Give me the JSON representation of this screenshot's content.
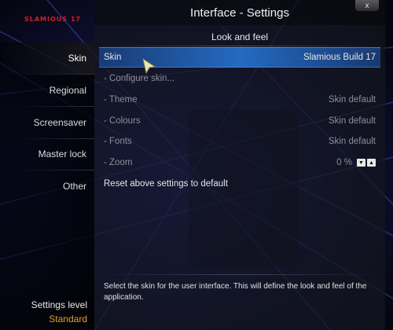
{
  "brand": {
    "logo_text": "SLAMIOUS 17"
  },
  "window": {
    "title": "Interface - Settings",
    "close_label": "x"
  },
  "sidebar": {
    "items": [
      {
        "label": "Skin",
        "active": true
      },
      {
        "label": "Regional",
        "active": false
      },
      {
        "label": "Screensaver",
        "active": false
      },
      {
        "label": "Master lock",
        "active": false
      },
      {
        "label": "Other",
        "active": false
      }
    ],
    "settings_level_label": "Settings level",
    "settings_level_value": "Standard"
  },
  "section": {
    "title": "Look and feel"
  },
  "settings": {
    "skin": {
      "label": "Skin",
      "value": "Slamious Build 17"
    },
    "configure": {
      "label": "- Configure skin..."
    },
    "theme": {
      "label": "- Theme",
      "value": "Skin default"
    },
    "colours": {
      "label": "- Colours",
      "value": "Skin default"
    },
    "fonts": {
      "label": "- Fonts",
      "value": "Skin default"
    },
    "zoom": {
      "label": "- Zoom",
      "value": "0 %"
    },
    "reset": {
      "label": "Reset above settings to default"
    }
  },
  "description": "Select the skin for the user interface. This will define the look and feel of the application.",
  "colors": {
    "accent_focus": "#2878dc",
    "brand_red": "#d42020",
    "level_value": "#e0a030"
  },
  "icons": {
    "zoom_down": "down-arrow-icon",
    "zoom_up": "up-arrow-icon",
    "pointer": "mouse-pointer-icon"
  }
}
